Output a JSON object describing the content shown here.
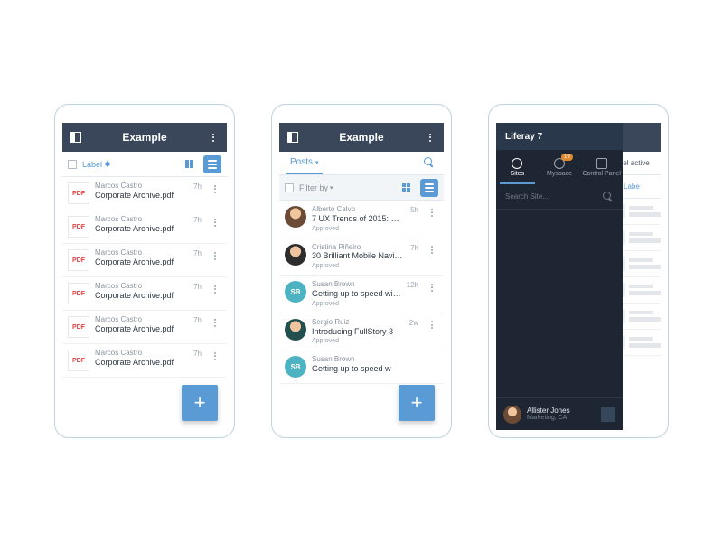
{
  "phone1": {
    "title": "Example",
    "sort_label": "Label",
    "pdf_badge": "PDF",
    "rows": [
      {
        "author": "Marcos Castro",
        "title": "Corporate Archive.pdf",
        "time": "7h"
      },
      {
        "author": "Marcos Castro",
        "title": "Corporate Archive.pdf",
        "time": "7h"
      },
      {
        "author": "Marcos Castro",
        "title": "Corporate Archive.pdf",
        "time": "7h"
      },
      {
        "author": "Marcos Castro",
        "title": "Corporate Archive.pdf",
        "time": "7h"
      },
      {
        "author": "Marcos Castro",
        "title": "Corporate Archive.pdf",
        "time": "7h"
      },
      {
        "author": "Marcos Castro",
        "title": "Corporate Archive.pdf",
        "time": "7h"
      }
    ]
  },
  "phone2": {
    "title": "Example",
    "tab": "Posts",
    "filter_label": "Filter by",
    "rows": [
      {
        "author": "Alberto Calvo",
        "title": "7 UX Trends of 2015: Get...",
        "status": "Approved",
        "time": "5h"
      },
      {
        "author": "Cristina Piñeiro",
        "title": "30 Brilliant Mobile Navigati...",
        "status": "Approved",
        "time": "7h"
      },
      {
        "author": "Susan Brown",
        "initials": "SB",
        "title": "Getting up to speed with Slack",
        "status": "Approved",
        "time": "12h"
      },
      {
        "author": "Sergio Ruiz",
        "title": "Introducing FullStory 3",
        "status": "Approved",
        "time": "2w"
      },
      {
        "author": "Susan Brown",
        "initials": "SB",
        "title": "Getting up to speed w",
        "status": "",
        "time": ""
      }
    ]
  },
  "phone3": {
    "brand": "Liferay 7",
    "tabs": {
      "sites": "Sites",
      "myspace": "Myspace",
      "control": "Control Panel",
      "badge": "19"
    },
    "search_placeholder": "Search Site...",
    "bg_label_active": "Label active",
    "bg_label_link": "Labe",
    "user": {
      "name": "Allister Jones",
      "sub": "Marketing, CA"
    }
  }
}
